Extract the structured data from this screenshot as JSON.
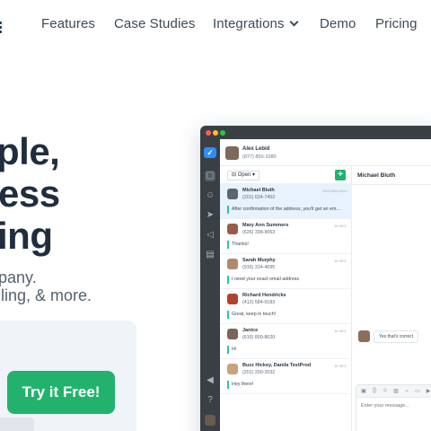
{
  "nav": {
    "items": [
      {
        "label": "Features"
      },
      {
        "label": "Case Studies"
      },
      {
        "label": "Integrations"
      },
      {
        "label": "Demo"
      },
      {
        "label": "Pricing"
      }
    ]
  },
  "hero": {
    "lines": [
      "ple,",
      "ess",
      "ing"
    ],
    "sub_lines": [
      "pany.",
      "lling, & more."
    ],
    "cta_label": "Try it Free!"
  },
  "app": {
    "header": {
      "name": "Alex Lebid",
      "phone": "(877) 850-1080"
    },
    "filter_label": "Open",
    "add_label": "+",
    "conversations": [
      {
        "name": "Michael Bluth",
        "phone": "(201) 634-7452",
        "time": "SECOND AGO",
        "message": "After confirmation of the address, you'll get an em...",
        "active": true
      },
      {
        "name": "Mary Ann Summers",
        "phone": "(626) 338-9063",
        "time": "16 SEC",
        "message": "Thanks!",
        "active": false
      },
      {
        "name": "Sarah Murphy",
        "phone": "(916) 314-4095",
        "time": "16 SEC",
        "message": "I need your exact email address",
        "active": false
      },
      {
        "name": "Richard Hendricks",
        "phone": "(412) 584-0183",
        "time": "",
        "message": "Great, keep in touch!",
        "active": false
      },
      {
        "name": "Janice",
        "phone": "(616) 800-8020",
        "time": "16 SEC",
        "message": "Hi",
        "active": false
      },
      {
        "name": "Buzz Hickey, Danila TestProd",
        "phone": "(201) 200-2032",
        "time": "16 SEC",
        "message": "Hey there!",
        "active": false
      }
    ],
    "detail": {
      "name": "Michael Bluth",
      "bubble": "Yes that's correct",
      "composer_placeholder": "Enter your message..."
    }
  },
  "colors": {
    "accent_green": "#23b26d",
    "brand_blue": "#2d8cff",
    "rail_dark": "#3a3f45",
    "active_row": "#e8f2fd"
  }
}
